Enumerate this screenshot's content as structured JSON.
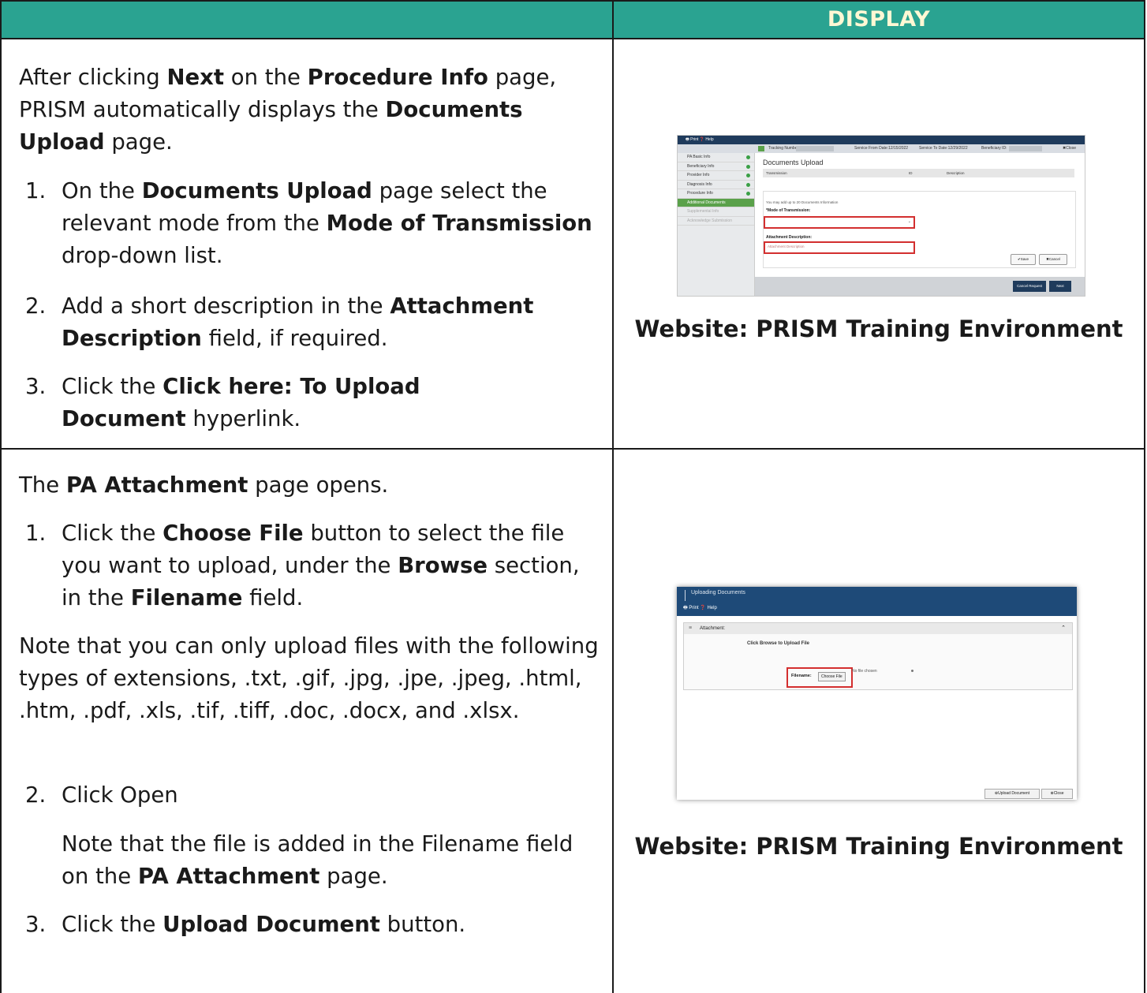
{
  "header": {
    "title": "DISPLAY"
  },
  "row1": {
    "intro": [
      "After clicking ",
      "Next",
      " on the ",
      "Procedure Info",
      " page, PRISM automatically displays the ",
      "Documents Upload",
      " page."
    ],
    "steps": [
      {
        "num": "1.",
        "parts": [
          "On the ",
          "Documents Upload",
          " page select the relevant mode from the ",
          "Mode of Transmission",
          " drop-down list."
        ]
      },
      {
        "num": "2.",
        "parts": [
          "Add a short description in the ",
          "Attachment Description",
          " field, if required."
        ]
      },
      {
        "num": "3.",
        "parts": [
          "Click the ",
          "Click here: To Upload Document",
          " hyperlink."
        ]
      }
    ],
    "caption": "Website: PRISM Training Environment",
    "screenshot": {
      "top_links": "🖶 Print  ❓ Help",
      "tracking_label": "Tracking Number:",
      "service_from": "Service From Date:12/15/2022",
      "service_to": "Service To Date:12/29/2022",
      "beneficiary": "Beneficiary ID:",
      "close": "✖Close",
      "sidebar": [
        "PA Basic Info",
        "Beneficiary Info",
        "Provider Info",
        "Diagnosis Info",
        "Procedure Info",
        "Additional Documents",
        "Supplemental Info",
        "Acknowledge Submission"
      ],
      "page_title": "Documents Upload",
      "col_transmission": "Transmission",
      "col_id": "ID",
      "col_description": "Description",
      "add_note": "You may add up to 20 Documents Information",
      "mode_label": "*Mode of Transmission:",
      "attach_label": "Attachment Description:",
      "attach_placeholder": "Attachment Description",
      "save": "✔Save",
      "cancel": "✖Cancel",
      "cancel_request": "Cancel Request",
      "next": "Next"
    }
  },
  "row2": {
    "intro": [
      "The ",
      "PA Attachment",
      " page opens."
    ],
    "step1": {
      "num": "1.",
      "parts": [
        "Click the ",
        "Choose File",
        " button to select the file you want to upload, under the ",
        "Browse",
        " section, in the ",
        "Filename",
        " field."
      ]
    },
    "note": "Note that you can only upload files with the following types of extensions, .txt, .gif, .jpg, .jpe, .jpeg, .html, .htm, .pdf, .xls, .tif, .tiff, .doc, .docx, and .xlsx.",
    "step2": {
      "num": "2.",
      "text": "Click Open"
    },
    "step2_note": [
      "Note that the file is added in the Filename field on the ",
      "PA Attachment",
      " page."
    ],
    "step3": {
      "num": "3.",
      "parts": [
        "Click the ",
        "Upload Document",
        " button."
      ]
    },
    "caption": "Website: PRISM Training Environment",
    "screenshot": {
      "title": "Uploading Documents",
      "links": "🖶 Print  ❓ Help",
      "section": "Attachment:",
      "browse_text": "Click Browse to Upload File",
      "filename_label": "Filename:",
      "choose_file": "Choose File",
      "no_file": "No file chosen",
      "upload_btn": "⊕Upload Document",
      "close_btn": "⊗Close"
    }
  }
}
